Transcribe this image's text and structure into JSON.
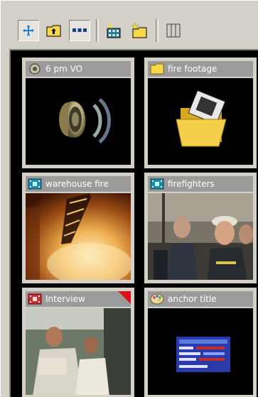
{
  "toolbar": {
    "buttons": [
      {
        "icon": "move-add-icon",
        "pressed": true
      },
      {
        "icon": "folder-up-icon",
        "pressed": false
      },
      {
        "icon": "thumbnail-view-icon",
        "pressed": true
      },
      {
        "icon": "new-bin-icon",
        "pressed": false
      },
      {
        "icon": "new-folder-icon",
        "pressed": false
      },
      {
        "icon": "column-view-icon",
        "pressed": false
      }
    ]
  },
  "items": [
    {
      "label": "6 pm VO",
      "type": "audio",
      "icon": "speaker-icon"
    },
    {
      "label": "fire footage",
      "type": "folder",
      "icon": "folder-icon"
    },
    {
      "label": "warehouse fire",
      "type": "video",
      "icon": "filmstrip-icon"
    },
    {
      "label": "firefighters",
      "type": "video",
      "icon": "filmstrip-icon"
    },
    {
      "label": "Interview",
      "type": "video",
      "icon": "red-filmstrip-icon",
      "flagged": true
    },
    {
      "label": "anchor title",
      "type": "title",
      "icon": "palette-icon"
    }
  ],
  "colors": {
    "panel": "#d4d0c8",
    "tile_header": "#9b9b9b",
    "flag": "#e01018",
    "grid_background": "#000000"
  }
}
